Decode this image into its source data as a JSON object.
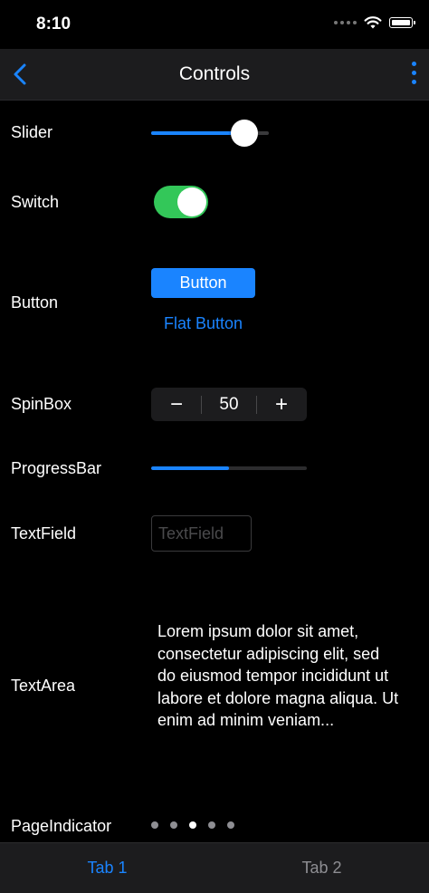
{
  "status_bar": {
    "time": "8:10"
  },
  "nav": {
    "title": "Controls",
    "back_icon": "chevron-left-icon",
    "menu_icon": "more-vertical-icon"
  },
  "controls": {
    "slider": {
      "label": "Slider",
      "value": 0.88
    },
    "switch": {
      "label": "Switch",
      "checked": true
    },
    "button": {
      "label": "Button",
      "primary_label": "Button",
      "flat_label": "Flat Button"
    },
    "spinbox": {
      "label": "SpinBox",
      "value": "50",
      "minus": "−",
      "plus": "+"
    },
    "progressbar": {
      "label": "ProgressBar",
      "value": 0.5
    },
    "textfield": {
      "label": "TextField",
      "placeholder": "TextField"
    },
    "textarea": {
      "label": "TextArea",
      "text": "Lorem ipsum dolor sit amet, consectetur adipiscing elit, sed do eiusmod tempor incididunt ut labore et dolore magna aliqua. Ut enim ad minim veniam..."
    },
    "pageindicator": {
      "label": "PageIndicator",
      "count": 5,
      "current": 2
    }
  },
  "tabs": [
    {
      "label": "Tab 1",
      "active": true
    },
    {
      "label": "Tab 2",
      "active": false
    }
  ],
  "colors": {
    "accent": "#1a84ff",
    "switch_on": "#33c759",
    "background": "#000000",
    "bar": "#1c1c1e"
  }
}
